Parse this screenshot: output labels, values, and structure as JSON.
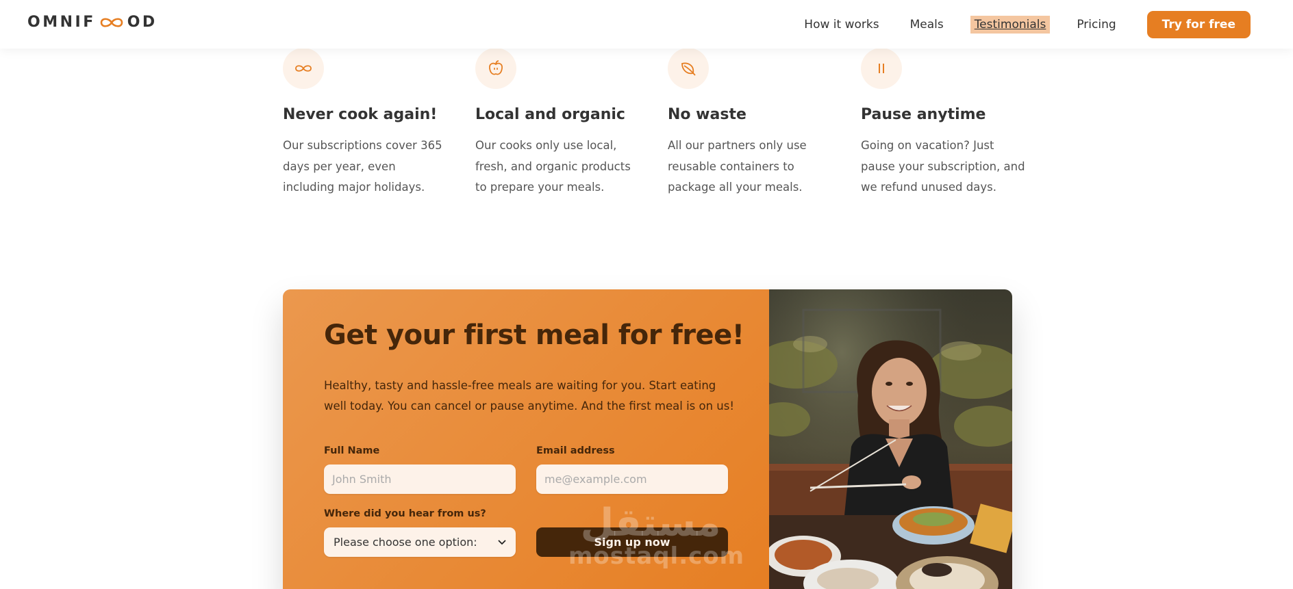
{
  "header": {
    "logo_left": "OMNIF",
    "logo_right": "OD",
    "nav": [
      {
        "label": "How it works"
      },
      {
        "label": "Meals"
      },
      {
        "label": "Testimonials"
      },
      {
        "label": "Pricing"
      }
    ],
    "cta_label": "Try for free"
  },
  "features": [
    {
      "icon": "infinity-icon",
      "title": "Never cook again!",
      "text": "Our subscriptions cover 365 days per year, even including major holidays."
    },
    {
      "icon": "apple-icon",
      "title": "Local and organic",
      "text": "Our cooks only use local, fresh, and organic products to prepare your meals."
    },
    {
      "icon": "leaf-icon",
      "title": "No waste",
      "text": "All our partners only use reusable containers to package all your meals."
    },
    {
      "icon": "pause-icon",
      "title": "Pause anytime",
      "text": "Going on vacation? Just pause your subscription, and we refund unused days."
    }
  ],
  "cta": {
    "title": "Get your first meal for free!",
    "text": "Healthy, tasty and hassle-free meals are waiting for you. Start eating well today. You can cancel or pause anytime. And the first meal is on us!",
    "form": {
      "name_label": "Full Name",
      "name_placeholder": "John Smith",
      "email_label": "Email address",
      "email_placeholder": "me@example.com",
      "source_label": "Where did you hear from us?",
      "source_selected": "Please choose one option:",
      "submit_label": "Sign up now"
    }
  },
  "watermark": {
    "arabic": "مستقل",
    "latin": "mostaql.com"
  },
  "colors": {
    "accent": "#e67e22",
    "accent_light": "#fdf2e9",
    "dark_brown": "#45260a",
    "active_nav_bg": "#f4c6a0"
  }
}
